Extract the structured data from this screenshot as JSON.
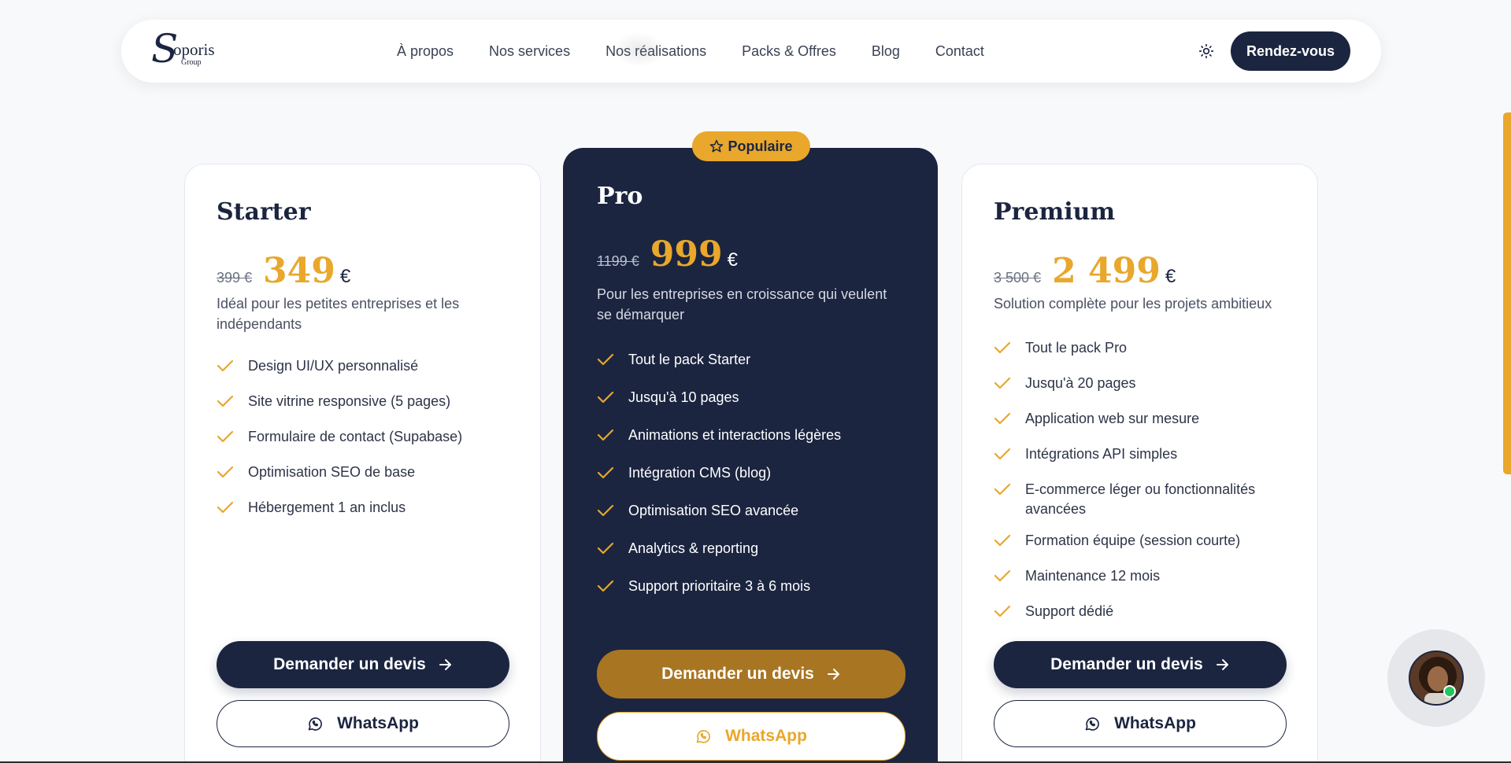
{
  "brand": {
    "logo_letter": "S",
    "logo_word": "oporis",
    "logo_sub": "Group"
  },
  "nav": {
    "links": [
      "À propos",
      "Nos services",
      "Nos réalisations",
      "Packs & Offres",
      "Blog",
      "Contact"
    ],
    "theme_toggle_icon": "sun-icon",
    "cta_label": "Rendez-vous"
  },
  "colors": {
    "navy": "#1b2540",
    "gold": "#e9a72c",
    "gold_dark": "#a87522",
    "online": "#22c55e"
  },
  "plans": {
    "starter": {
      "name": "Starter",
      "old_price": "399 €",
      "price": "349",
      "currency": "€",
      "description": "Idéal pour les petites entreprises et les indépendants",
      "features": [
        "Design UI/UX personnalisé",
        "Site vitrine responsive (5 pages)",
        "Formulaire de contact (Supabase)",
        "Optimisation SEO de base",
        "Hébergement 1 an inclus"
      ],
      "devis_label": "Demander un devis",
      "whatsapp_label": "WhatsApp"
    },
    "pro": {
      "badge": "Populaire",
      "name": "Pro",
      "old_price": "1199 €",
      "price": "999",
      "currency": "€",
      "description": "Pour les entreprises en croissance qui veulent se démarquer",
      "features": [
        "Tout le pack Starter",
        "Jusqu'à 10 pages",
        "Animations et interactions légères",
        "Intégration CMS (blog)",
        "Optimisation SEO avancée",
        "Analytics & reporting",
        "Support prioritaire 3 à 6 mois"
      ],
      "devis_label": "Demander un devis",
      "whatsapp_label": "WhatsApp"
    },
    "premium": {
      "name": "Premium",
      "old_price": "3 500 €",
      "price": "2 499",
      "currency": "€",
      "description": "Solution complète pour les projets ambitieux",
      "features": [
        "Tout le pack Pro",
        "Jusqu'à 20 pages",
        "Application web sur mesure",
        "Intégrations API simples",
        "E-commerce léger ou fonctionnalités avancées",
        "Formation équipe (session courte)",
        "Maintenance 12 mois",
        "Support dédié"
      ],
      "devis_label": "Demander un devis",
      "whatsapp_label": "WhatsApp"
    }
  },
  "chat": {
    "avatar_icon": "support-agent-avatar",
    "status": "online"
  }
}
